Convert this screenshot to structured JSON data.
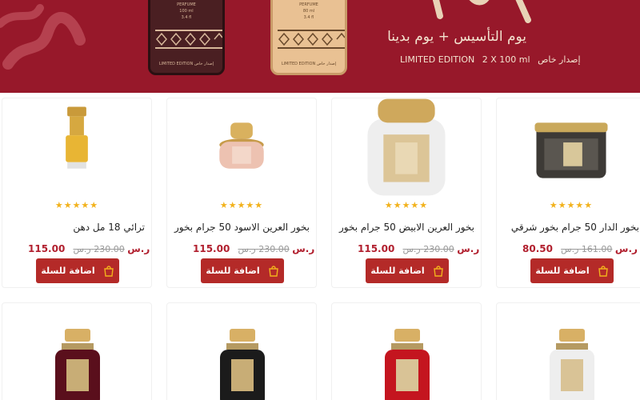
{
  "banner": {
    "title": "يوم التأسيس + يوم بدينا",
    "edition_ar": "إصدار خاص",
    "edition_en": "LIMITED EDITION",
    "size": "2 X 100 ml",
    "box_dark_top": "PERFUME",
    "box_dark_vol": "100 ml",
    "box_dark_vol2": "3.4 fl",
    "box_dark_bottom": "LIMITED EDITION  إصدار خاص",
    "box_light_top": "PERFUME",
    "box_light_vol": "80 ml",
    "box_light_vol2": "3.4 fl",
    "box_light_bottom": "LIMITED EDITION  إصدار خاص"
  },
  "currency": "ر.س",
  "cart_label": "اضافة للسلة",
  "stars": "★★★★★",
  "products": [
    {
      "name": "بخور الدار 50 جرام بخور شرقي",
      "price": "80.50",
      "old_price": "161.00"
    },
    {
      "name": "بخور العرين الابيض 50 جرام بخور",
      "price": "115.00",
      "old_price": "230.00"
    },
    {
      "name": "بخور العرين الاسود 50 جرام بخور",
      "price": "115.00",
      "old_price": "230.00"
    },
    {
      "name": "ترائي 18 مل دهن",
      "price": "115.00",
      "old_price": "230.00"
    }
  ],
  "colors": {
    "banner_bg": "#97182a",
    "button_bg": "#b42a28",
    "price": "#b11f2e",
    "star": "#f2b21c"
  }
}
